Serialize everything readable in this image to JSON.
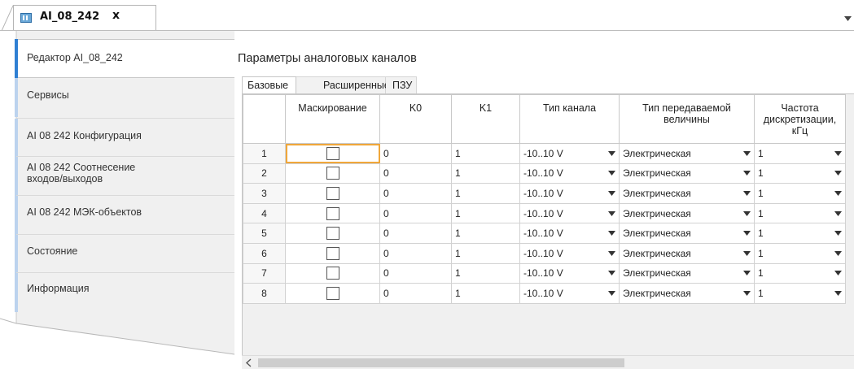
{
  "document_tab": {
    "title": "AI_08_242",
    "close_label": "x"
  },
  "sidebar": {
    "items": [
      {
        "label": "Редактор AI_08_242"
      },
      {
        "label": "Сервисы"
      },
      {
        "label": "AI 08 242 Конфигурация"
      },
      {
        "label": "AI 08 242 Соотнесение\nвходов/выходов"
      },
      {
        "label": "AI 08 242 МЭК-объектов"
      },
      {
        "label": "Состояние"
      },
      {
        "label": "Информация"
      }
    ],
    "active_index": 0
  },
  "main": {
    "title": "Параметры аналоговых каналов",
    "tabs": [
      {
        "label": "Базовые"
      },
      {
        "label": "Расширенные"
      },
      {
        "label": "ПЗУ"
      }
    ],
    "active_tab": 0
  },
  "table": {
    "columns": [
      "",
      "Маскирование",
      "K0",
      "K1",
      "Тип канала",
      "Тип передаваемой\nвеличины",
      "Частота\nдискретизации,\nкГц"
    ],
    "rows": [
      {
        "num": "1",
        "masked": false,
        "k0": "0",
        "k1": "1",
        "channel_type": "-10..10 V",
        "value_type": "Электрическая",
        "frequency": "1"
      },
      {
        "num": "2",
        "masked": false,
        "k0": "0",
        "k1": "1",
        "channel_type": "-10..10 V",
        "value_type": "Электрическая",
        "frequency": "1"
      },
      {
        "num": "3",
        "masked": false,
        "k0": "0",
        "k1": "1",
        "channel_type": "-10..10 V",
        "value_type": "Электрическая",
        "frequency": "1"
      },
      {
        "num": "4",
        "masked": false,
        "k0": "0",
        "k1": "1",
        "channel_type": "-10..10 V",
        "value_type": "Электрическая",
        "frequency": "1"
      },
      {
        "num": "5",
        "masked": false,
        "k0": "0",
        "k1": "1",
        "channel_type": "-10..10 V",
        "value_type": "Электрическая",
        "frequency": "1"
      },
      {
        "num": "6",
        "masked": false,
        "k0": "0",
        "k1": "1",
        "channel_type": "-10..10 V",
        "value_type": "Электрическая",
        "frequency": "1"
      },
      {
        "num": "7",
        "masked": false,
        "k0": "0",
        "k1": "1",
        "channel_type": "-10..10 V",
        "value_type": "Электрическая",
        "frequency": "1"
      },
      {
        "num": "8",
        "masked": false,
        "k0": "0",
        "k1": "1",
        "channel_type": "-10..10 V",
        "value_type": "Электрическая",
        "frequency": "1"
      }
    ]
  },
  "scrollbar": {
    "left_arrow": "<"
  },
  "colors": {
    "active_nav_bar": "#2f7fd3",
    "selection_outline": "#f0a73a",
    "tab_accent": "#e8a33d"
  }
}
